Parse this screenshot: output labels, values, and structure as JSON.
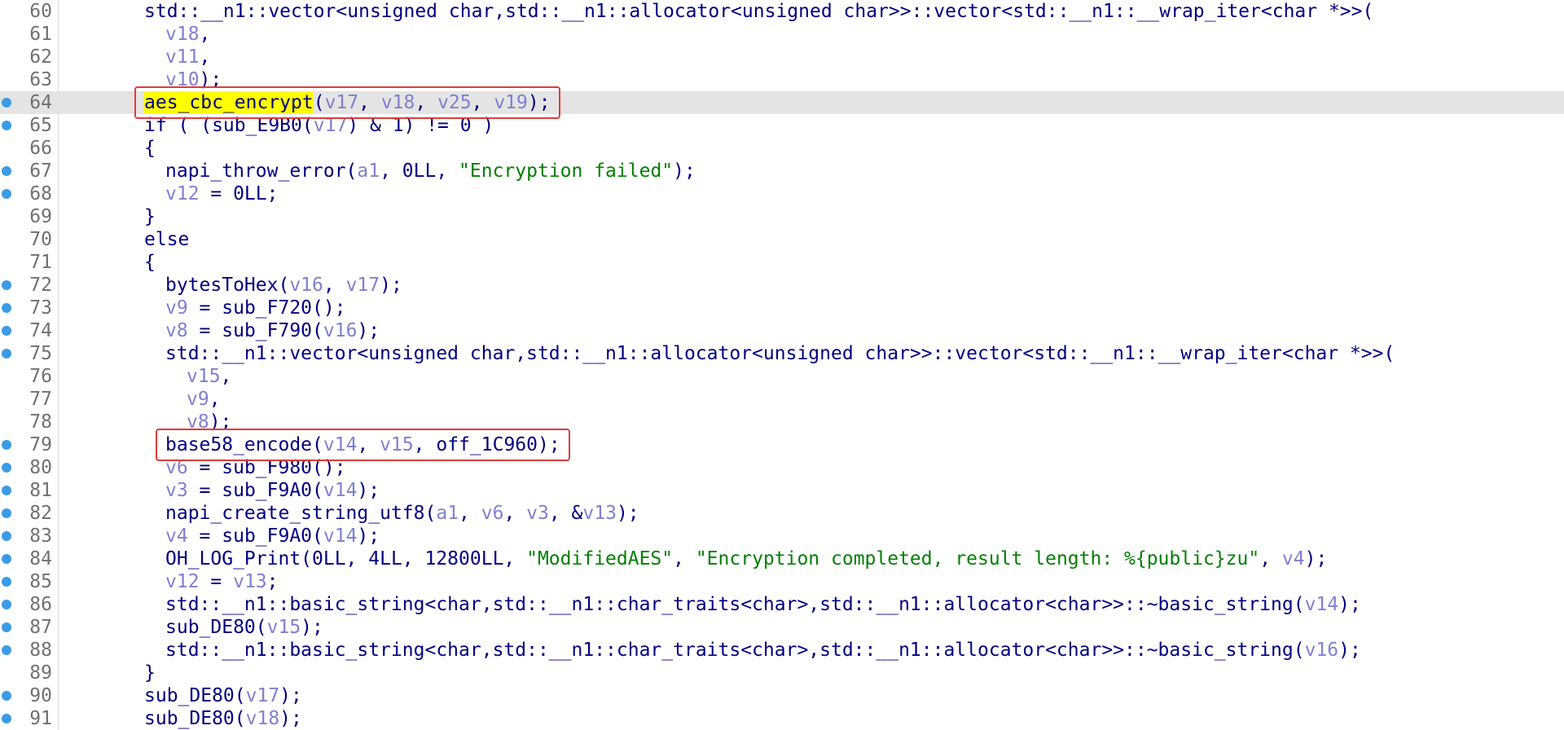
{
  "editor": {
    "highlighted_line": "64",
    "boxed_calls": [
      "aes_cbc_encrypt",
      "base58_encode"
    ],
    "colors": {
      "identifier": "#000080",
      "variable": "#8080d0",
      "string": "#008000",
      "line_highlight": "#e4e4e4",
      "word_highlight": "#ffff00",
      "breakpoint": "#3b9be6",
      "box_border": "#e23a3a"
    },
    "lines": [
      {
        "num": "60",
        "bp": false,
        "indent": 0,
        "tokens": [
          [
            "std::__n1::vector<unsigned char,std::__n1::allocator<unsigned char>>::vector<std::__n1::__wrap_iter<char *>>(",
            "i"
          ]
        ]
      },
      {
        "num": "61",
        "bp": false,
        "indent": 1,
        "tokens": [
          [
            "v18",
            "v"
          ],
          [
            ",",
            "i"
          ]
        ]
      },
      {
        "num": "62",
        "bp": false,
        "indent": 1,
        "tokens": [
          [
            "v11",
            "v"
          ],
          [
            ",",
            "i"
          ]
        ]
      },
      {
        "num": "63",
        "bp": false,
        "indent": 1,
        "tokens": [
          [
            "v10",
            "v"
          ],
          [
            ");",
            "i"
          ]
        ]
      },
      {
        "num": "64",
        "bp": true,
        "indent": 0,
        "tokens": [
          [
            "aes_cbc_encrypt",
            "h"
          ],
          [
            "(",
            "i"
          ],
          [
            "v17",
            "v"
          ],
          [
            ", ",
            "i"
          ],
          [
            "v18",
            "v"
          ],
          [
            ", ",
            "i"
          ],
          [
            "v25",
            "v"
          ],
          [
            ", ",
            "i"
          ],
          [
            "v19",
            "v"
          ],
          [
            ");",
            "i"
          ]
        ]
      },
      {
        "num": "65",
        "bp": true,
        "indent": 0,
        "tokens": [
          [
            "if ( (sub_E9B0(",
            "i"
          ],
          [
            "v17",
            "v"
          ],
          [
            ") & 1) != 0 )",
            "i"
          ]
        ]
      },
      {
        "num": "66",
        "bp": false,
        "indent": 0,
        "tokens": [
          [
            "{",
            "i"
          ]
        ]
      },
      {
        "num": "67",
        "bp": true,
        "indent": 1,
        "tokens": [
          [
            "napi_throw_error(",
            "i"
          ],
          [
            "a1",
            "v"
          ],
          [
            ", 0LL, ",
            "i"
          ],
          [
            "\"Encryption failed\"",
            "s"
          ],
          [
            ");",
            "i"
          ]
        ]
      },
      {
        "num": "68",
        "bp": true,
        "indent": 1,
        "tokens": [
          [
            "v12",
            "v"
          ],
          [
            " = 0LL;",
            "i"
          ]
        ]
      },
      {
        "num": "69",
        "bp": false,
        "indent": 0,
        "tokens": [
          [
            "}",
            "i"
          ]
        ]
      },
      {
        "num": "70",
        "bp": false,
        "indent": 0,
        "tokens": [
          [
            "else",
            "i"
          ]
        ]
      },
      {
        "num": "71",
        "bp": false,
        "indent": 0,
        "tokens": [
          [
            "{",
            "i"
          ]
        ]
      },
      {
        "num": "72",
        "bp": true,
        "indent": 1,
        "tokens": [
          [
            "bytesToHex(",
            "i"
          ],
          [
            "v16",
            "v"
          ],
          [
            ", ",
            "i"
          ],
          [
            "v17",
            "v"
          ],
          [
            ");",
            "i"
          ]
        ]
      },
      {
        "num": "73",
        "bp": true,
        "indent": 1,
        "tokens": [
          [
            "v9",
            "v"
          ],
          [
            " = sub_F720();",
            "i"
          ]
        ]
      },
      {
        "num": "74",
        "bp": true,
        "indent": 1,
        "tokens": [
          [
            "v8",
            "v"
          ],
          [
            " = sub_F790(",
            "i"
          ],
          [
            "v16",
            "v"
          ],
          [
            ");",
            "i"
          ]
        ]
      },
      {
        "num": "75",
        "bp": true,
        "indent": 1,
        "tokens": [
          [
            "std::__n1::vector<unsigned char,std::__n1::allocator<unsigned char>>::vector<std::__n1::__wrap_iter<char *>>(",
            "i"
          ]
        ]
      },
      {
        "num": "76",
        "bp": false,
        "indent": 2,
        "tokens": [
          [
            "v15",
            "v"
          ],
          [
            ",",
            "i"
          ]
        ]
      },
      {
        "num": "77",
        "bp": false,
        "indent": 2,
        "tokens": [
          [
            "v9",
            "v"
          ],
          [
            ",",
            "i"
          ]
        ]
      },
      {
        "num": "78",
        "bp": false,
        "indent": 2,
        "tokens": [
          [
            "v8",
            "v"
          ],
          [
            ");",
            "i"
          ]
        ]
      },
      {
        "num": "79",
        "bp": true,
        "indent": 1,
        "tokens": [
          [
            "base58_encode(",
            "i"
          ],
          [
            "v14",
            "v"
          ],
          [
            ", ",
            "i"
          ],
          [
            "v15",
            "v"
          ],
          [
            ", off_1C960);",
            "i"
          ]
        ]
      },
      {
        "num": "80",
        "bp": true,
        "indent": 1,
        "tokens": [
          [
            "v6",
            "v"
          ],
          [
            " = sub_F980();",
            "i"
          ]
        ]
      },
      {
        "num": "81",
        "bp": true,
        "indent": 1,
        "tokens": [
          [
            "v3",
            "v"
          ],
          [
            " = sub_F9A0(",
            "i"
          ],
          [
            "v14",
            "v"
          ],
          [
            ");",
            "i"
          ]
        ]
      },
      {
        "num": "82",
        "bp": true,
        "indent": 1,
        "tokens": [
          [
            "napi_create_string_utf8(",
            "i"
          ],
          [
            "a1",
            "v"
          ],
          [
            ", ",
            "i"
          ],
          [
            "v6",
            "v"
          ],
          [
            ", ",
            "i"
          ],
          [
            "v3",
            "v"
          ],
          [
            ", &",
            "i"
          ],
          [
            "v13",
            "v"
          ],
          [
            ");",
            "i"
          ]
        ]
      },
      {
        "num": "83",
        "bp": true,
        "indent": 1,
        "tokens": [
          [
            "v4",
            "v"
          ],
          [
            " = sub_F9A0(",
            "i"
          ],
          [
            "v14",
            "v"
          ],
          [
            ");",
            "i"
          ]
        ]
      },
      {
        "num": "84",
        "bp": true,
        "indent": 1,
        "tokens": [
          [
            "OH_LOG_Print(0LL, 4LL, 12800LL, ",
            "i"
          ],
          [
            "\"ModifiedAES\"",
            "s"
          ],
          [
            ", ",
            "i"
          ],
          [
            "\"Encryption completed, result length: %{public}zu\"",
            "s"
          ],
          [
            ", ",
            "i"
          ],
          [
            "v4",
            "v"
          ],
          [
            ");",
            "i"
          ]
        ]
      },
      {
        "num": "85",
        "bp": true,
        "indent": 1,
        "tokens": [
          [
            "v12",
            "v"
          ],
          [
            " = ",
            "i"
          ],
          [
            "v13",
            "v"
          ],
          [
            ";",
            "i"
          ]
        ]
      },
      {
        "num": "86",
        "bp": true,
        "indent": 1,
        "tokens": [
          [
            "std::__n1::basic_string<char,std::__n1::char_traits<char>,std::__n1::allocator<char>>::~basic_string(",
            "i"
          ],
          [
            "v14",
            "v"
          ],
          [
            ");",
            "i"
          ]
        ]
      },
      {
        "num": "87",
        "bp": true,
        "indent": 1,
        "tokens": [
          [
            "sub_DE80(",
            "i"
          ],
          [
            "v15",
            "v"
          ],
          [
            ");",
            "i"
          ]
        ]
      },
      {
        "num": "88",
        "bp": true,
        "indent": 1,
        "tokens": [
          [
            "std::__n1::basic_string<char,std::__n1::char_traits<char>,std::__n1::allocator<char>>::~basic_string(",
            "i"
          ],
          [
            "v16",
            "v"
          ],
          [
            ");",
            "i"
          ]
        ]
      },
      {
        "num": "89",
        "bp": false,
        "indent": 0,
        "tokens": [
          [
            "}",
            "i"
          ]
        ]
      },
      {
        "num": "90",
        "bp": true,
        "indent": 0,
        "tokens": [
          [
            "sub_DE80(",
            "i"
          ],
          [
            "v17",
            "v"
          ],
          [
            ");",
            "i"
          ]
        ]
      },
      {
        "num": "91",
        "bp": true,
        "indent": 0,
        "tokens": [
          [
            "sub_DE80(",
            "i"
          ],
          [
            "v18",
            "v"
          ],
          [
            ");",
            "i"
          ]
        ]
      }
    ]
  }
}
